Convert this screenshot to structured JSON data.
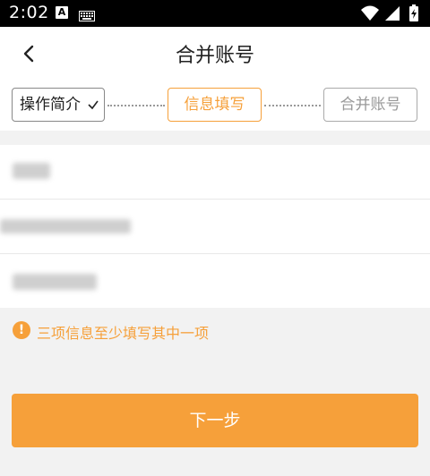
{
  "status_bar": {
    "time": "2:02",
    "notification_app_letter": "A",
    "icons": [
      "keyboard-icon",
      "wifi-icon",
      "signal-icon",
      "battery-charging-icon"
    ]
  },
  "header": {
    "title": "合并账号",
    "back_icon": "chevron-left-icon"
  },
  "steps": [
    {
      "label": "操作简介",
      "state": "done"
    },
    {
      "label": "信息填写",
      "state": "active"
    },
    {
      "label": "合并账号",
      "state": "pending"
    }
  ],
  "form": {
    "fields": [
      {
        "name": "field-1",
        "value": ""
      },
      {
        "name": "field-2",
        "value": ""
      },
      {
        "name": "field-3",
        "value": ""
      }
    ]
  },
  "hint": {
    "icon": "exclamation-circle-icon",
    "text": "三项信息至少填写其中一项"
  },
  "next_button": {
    "label": "下一步"
  },
  "colors": {
    "accent": "#f6a03a",
    "background": "#f2f2f2",
    "status_bar": "#000000"
  }
}
